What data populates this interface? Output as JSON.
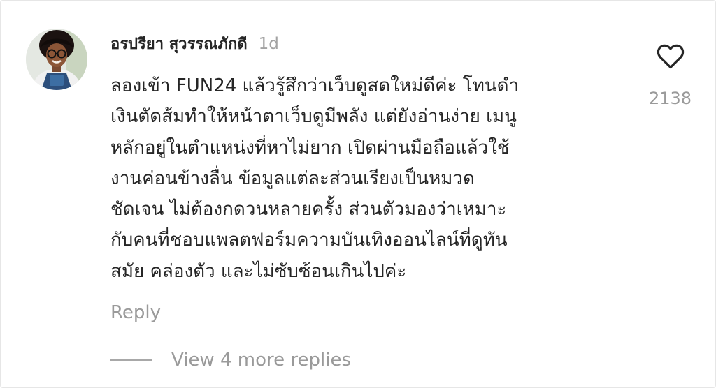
{
  "comment": {
    "username": "อรปรียา สุวรรณภักดี",
    "timestamp": "1d",
    "body": "ลองเข้า FUN24 แล้วรู้สึกว่าเว็บดูสดใหม่ดีค่ะ โทนดำ\nเงินตัดส้มทำให้หน้าตาเว็บดูมีพลัง แต่ยังอ่านง่าย เมนู\nหลักอยู่ในตำแหน่งที่หาไม่ยาก เปิดผ่านมือถือแล้วใช้\nงานค่อนข้างลื่น ข้อมูลแต่ละส่วนเรียงเป็นหมวด\nชัดเจน ไม่ต้องกดวนหลายครั้ง ส่วนตัวมองว่าเหมาะ\nกับคนที่ชอบแพลตฟอร์มความบันเทิงออนไลน์ที่ดูทัน\nสมัย คล่องตัว และไม่ซับซ้อนเกินไปค่ะ",
    "like_count": "2138",
    "reply_label": "Reply",
    "view_replies_label": "View 4 more replies",
    "like_icon": "heart-outline-icon"
  }
}
